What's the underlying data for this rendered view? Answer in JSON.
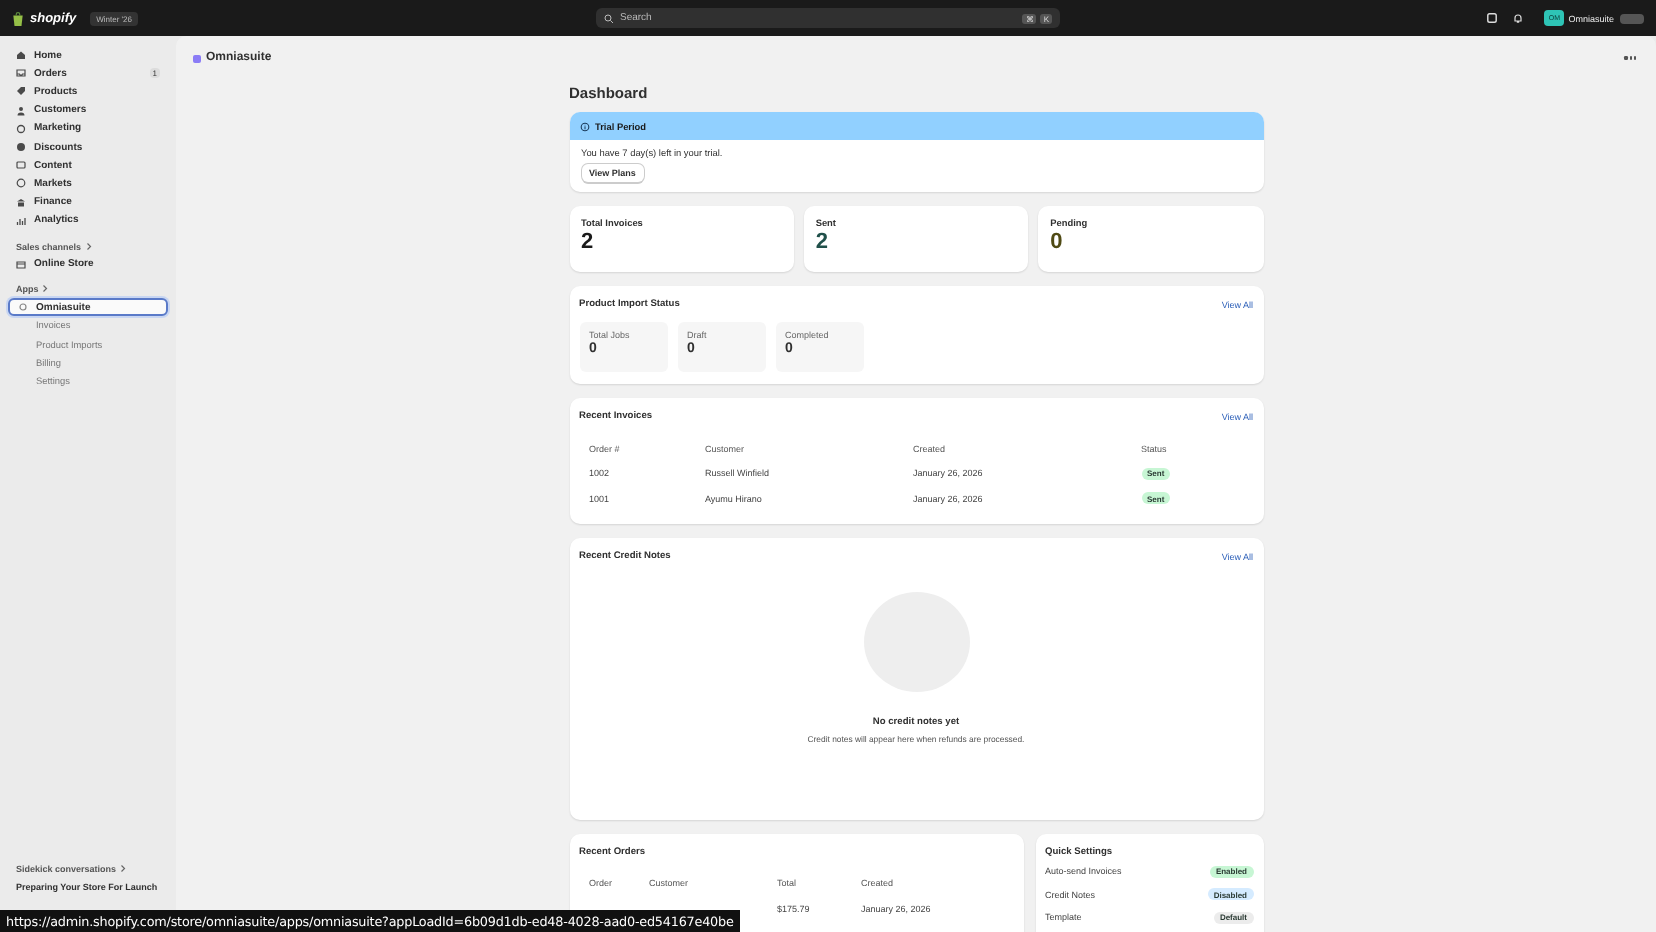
{
  "topbar": {
    "logo": "shopify",
    "edition": "Winter '26",
    "search": {
      "placeholder": "Search",
      "shortcut": [
        "⌘",
        "K"
      ]
    },
    "store_name": "Omniasuite",
    "avatar_initials": "OM"
  },
  "sidebar": {
    "items": [
      {
        "label": "Home",
        "selected": false
      },
      {
        "label": "Orders",
        "selected": false,
        "badge": "1"
      },
      {
        "label": "Products",
        "selected": false
      },
      {
        "label": "Customers",
        "selected": false
      },
      {
        "label": "Marketing",
        "selected": false
      },
      {
        "label": "Discounts",
        "selected": false
      },
      {
        "label": "Content",
        "selected": false
      },
      {
        "label": "Markets",
        "selected": false
      },
      {
        "label": "Finance",
        "selected": false
      },
      {
        "label": "Analytics",
        "selected": false
      }
    ],
    "sales_channels": {
      "heading": "Sales channels",
      "items": [
        {
          "label": "Online Store",
          "selected": false
        }
      ]
    },
    "apps": {
      "heading": "Apps",
      "items": [
        {
          "label": "Omniasuite",
          "selected": true,
          "children": [
            {
              "label": "Invoices"
            },
            {
              "label": "Product Imports"
            },
            {
              "label": "Billing"
            },
            {
              "label": "Settings"
            }
          ]
        }
      ]
    },
    "footer": [
      {
        "label": "Sidekick conversations",
        "kind": "heading"
      },
      {
        "label": "Preparing Your Store For Launch",
        "kind": "link"
      }
    ]
  },
  "app_title": "Omniasuite",
  "page_title": "Dashboard",
  "trial": {
    "title": "Trial Period",
    "message": "You have 7 day(s) left in your trial.",
    "button": "View Plans"
  },
  "stats": [
    {
      "label": "Total Invoices",
      "value": "2",
      "color": "#1a1a1a"
    },
    {
      "label": "Sent",
      "value": "2",
      "color": "#20504a"
    },
    {
      "label": "Pending",
      "value": "0",
      "color": "#4f4a14"
    }
  ],
  "product_import": {
    "title": "Product Import Status",
    "link": "View All",
    "stats": [
      {
        "label": "Total Jobs",
        "value": "0"
      },
      {
        "label": "Draft",
        "value": "0"
      },
      {
        "label": "Completed",
        "value": "0"
      }
    ]
  },
  "recent_invoices": {
    "title": "Recent Invoices",
    "link": "View All",
    "columns": [
      "Order #",
      "Customer",
      "Created",
      "Status"
    ],
    "rows": [
      {
        "order": "1002",
        "customer": "Russell Winfield",
        "created": "January 26, 2026",
        "status": {
          "label": "Sent",
          "color": "#c7f6d4"
        }
      },
      {
        "order": "1001",
        "customer": "Ayumu Hirano",
        "created": "January 26, 2026",
        "status": {
          "label": "Sent",
          "color": "#c7f6d4"
        }
      }
    ]
  },
  "recent_credit_notes": {
    "title": "Recent Credit Notes",
    "link": "View All",
    "empty_title": "No credit notes yet",
    "empty_message": "Credit notes will appear here when refunds are processed."
  },
  "recent_orders": {
    "title": "Recent Orders",
    "columns": [
      "Order",
      "Customer",
      "Total",
      "Created"
    ],
    "rows": [
      {
        "total": "$175.79",
        "created": "January 26, 2026"
      }
    ]
  },
  "quick_settings": {
    "title": "Quick Settings",
    "items": [
      {
        "label": "Auto-send Invoices",
        "status": {
          "label": "Enabled",
          "color": "#c7f6d4"
        }
      },
      {
        "label": "Credit Notes",
        "status": {
          "label": "Disabled",
          "color": "#d5ebff"
        }
      },
      {
        "label": "Template",
        "status": {
          "label": "Default",
          "color": "#ececec"
        }
      }
    ]
  },
  "status_bar": {
    "url": "https://admin.shopify.com/store/omniasuite/apps/omniasuite?appLoadId=6b09d1db-ed48-4028-aad0-ed54167e40be"
  }
}
